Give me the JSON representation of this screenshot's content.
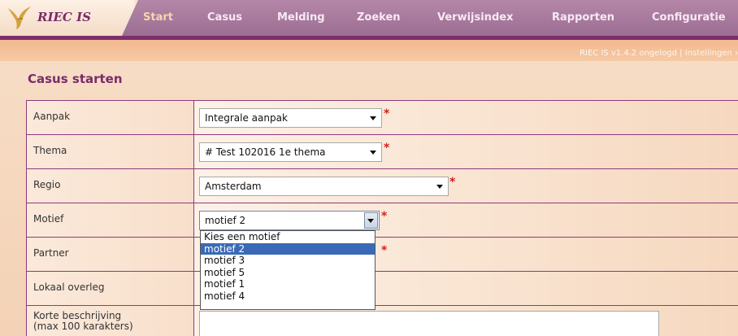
{
  "app": {
    "logo_text": "RIEC IS"
  },
  "nav": {
    "items": [
      {
        "label": "Start"
      },
      {
        "label": "Casus"
      },
      {
        "label": "Melding"
      },
      {
        "label": "Zoeken"
      },
      {
        "label": "Verwijsindex"
      },
      {
        "label": "Rapporten"
      },
      {
        "label": "Configuratie"
      }
    ]
  },
  "breadcrumb": "RIEC IS v1.4.2 ongelogd | Instellingen ›",
  "page": {
    "title": "Casus starten"
  },
  "form": {
    "rows": [
      {
        "label": "Aanpak",
        "value": "Integrale aanpak"
      },
      {
        "label": "Thema",
        "value": "# Test 102016 1e thema"
      },
      {
        "label": "Regio",
        "value": "Amsterdam"
      },
      {
        "label": "Motief",
        "value": "motief 2"
      },
      {
        "label": "Partner",
        "value": ""
      },
      {
        "label": "Lokaal overleg",
        "value": ""
      },
      {
        "label_line1": "Korte beschrijving",
        "label_line2": "(max 100 karakters)",
        "value": ""
      }
    ],
    "required_marker": "*"
  },
  "motief_dropdown": {
    "options": [
      "Kies een motief",
      "motief 2",
      "motief 3",
      "motief 5",
      "motief 1",
      "motief 4"
    ],
    "selected": "motief 2"
  },
  "colors": {
    "brand_purple": "#7d2e6b",
    "nav_bg": "#a87b9d",
    "selection_blue": "#3a6ab5",
    "required_red": "#d12020"
  }
}
